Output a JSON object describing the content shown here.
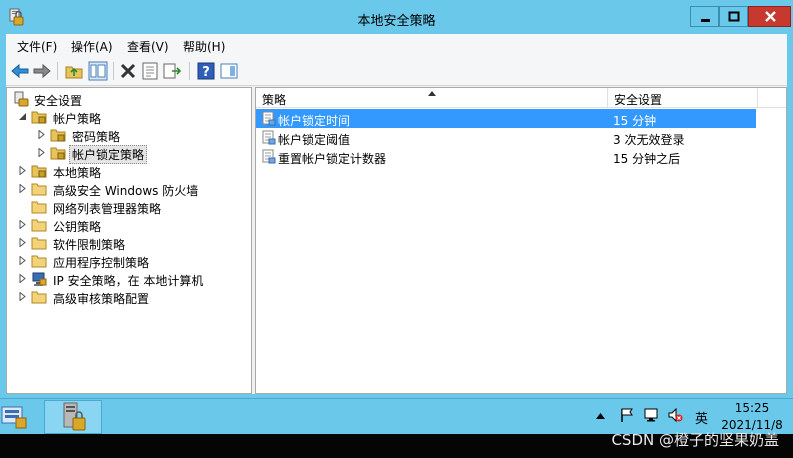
{
  "window": {
    "title": "本地安全策略",
    "colors": {
      "frame": "#6ac8ea",
      "close": "#c7392f",
      "selection": "#3399ff"
    }
  },
  "menu": [
    "文件(F)",
    "操作(A)",
    "查看(V)",
    "帮助(H)"
  ],
  "toolbar": {
    "icons": [
      "back-icon",
      "forward-icon",
      "up-folder-icon",
      "show-hide-tree-icon",
      "delete-icon",
      "properties-icon",
      "export-list-icon",
      "help-icon",
      "show-action-pane-icon"
    ]
  },
  "tree": {
    "root": "安全设置",
    "items": [
      {
        "label": "帐户策略",
        "state": "expanded"
      },
      {
        "label": "密码策略",
        "state": "collapsed"
      },
      {
        "label": "帐户锁定策略",
        "state": "collapsed",
        "selected": true
      },
      {
        "label": "本地策略",
        "state": "collapsed"
      },
      {
        "label": "高级安全 Windows 防火墙",
        "state": "collapsed"
      },
      {
        "label": "网络列表管理器策略",
        "state": "none"
      },
      {
        "label": "公钥策略",
        "state": "collapsed"
      },
      {
        "label": "软件限制策略",
        "state": "collapsed"
      },
      {
        "label": "应用程序控制策略",
        "state": "collapsed"
      },
      {
        "label": "IP 安全策略，在 本地计算机",
        "state": "collapsed"
      },
      {
        "label": "高级审核策略配置",
        "state": "collapsed"
      }
    ]
  },
  "list": {
    "columns": [
      "策略",
      "安全设置"
    ],
    "sort_column": "策略",
    "rows": [
      {
        "policy": "帐户锁定时间",
        "setting": "15 分钟",
        "selected": true
      },
      {
        "policy": "帐户锁定阈值",
        "setting": "3 次无效登录"
      },
      {
        "policy": "重置帐户锁定计数器",
        "setting": "15 分钟之后"
      }
    ]
  },
  "taskbar": {
    "ime": "英",
    "time": "15:25",
    "date": "2021/11/8",
    "tray_icons": [
      "show-hidden-icons-icon",
      "action-center-flag-icon",
      "network-icon",
      "volume-muted-icon"
    ]
  },
  "watermark": "CSDN @橙子的坚果奶盖"
}
